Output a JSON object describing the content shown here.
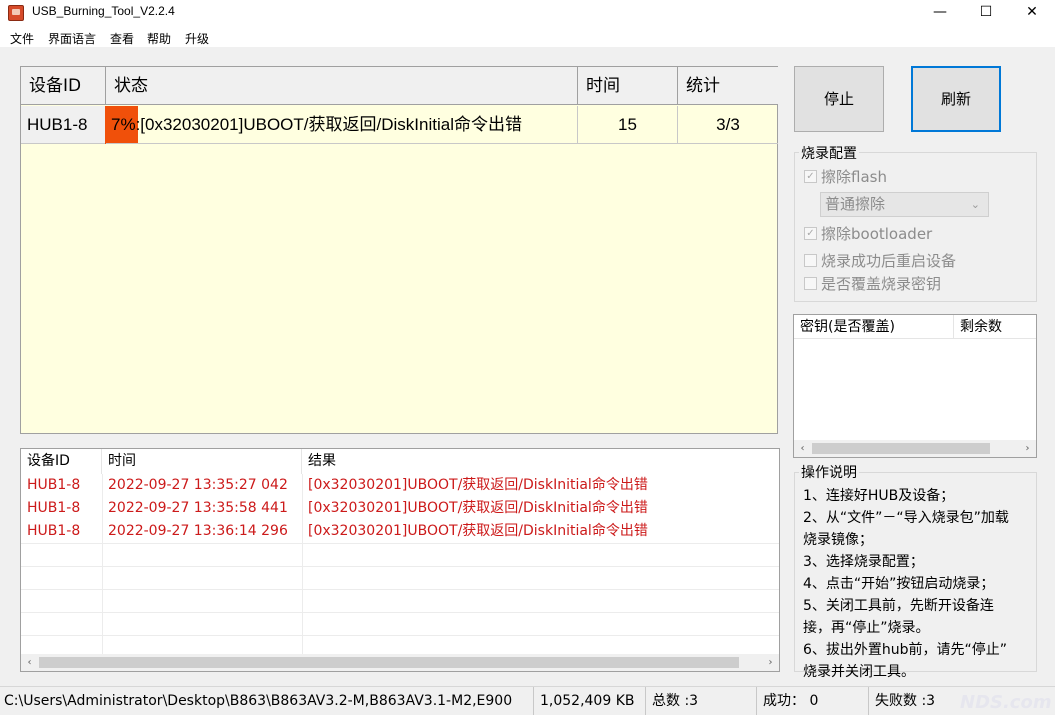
{
  "window": {
    "title": "USB_Burning_Tool_V2.2.4",
    "minimize": "—",
    "maximize": "☐",
    "close": "✕"
  },
  "menu": [
    "文件",
    "界面语言",
    "查看",
    "帮助",
    "升级"
  ],
  "device_grid": {
    "headers": [
      "设备ID",
      "状态",
      "时间",
      "统计"
    ],
    "rows": [
      {
        "device_id": "HUB1-8",
        "progress": "7%",
        "progress_value": 7,
        "status": ":[0x32030201]UBOOT/获取返回/DiskInitial命令出错",
        "time": "15",
        "count": "3/3"
      }
    ]
  },
  "buttons": {
    "stop": "停止",
    "refresh": "刷新"
  },
  "burn_config": {
    "title": "烧录配置",
    "erase_flash": {
      "label": "擦除flash",
      "checked": true
    },
    "erase_mode": "普通擦除",
    "erase_bootloader": {
      "label": "擦除bootloader",
      "checked": true
    },
    "reboot_after": {
      "label": "烧录成功后重启设备",
      "checked": false
    },
    "overwrite_key": {
      "label": "是否覆盖烧录密钥",
      "checked": false
    }
  },
  "key_list": {
    "headers": [
      "密钥(是否覆盖)",
      "剩余数"
    ]
  },
  "log_list": {
    "headers": [
      "设备ID",
      "时间",
      "结果"
    ],
    "rows": [
      {
        "device_id": "HUB1-8",
        "time": "2022-09-27 13:35:27 042",
        "result": "[0x32030201]UBOOT/获取返回/DiskInitial命令出错"
      },
      {
        "device_id": "HUB1-8",
        "time": "2022-09-27 13:35:58 441",
        "result": "[0x32030201]UBOOT/获取返回/DiskInitial命令出错"
      },
      {
        "device_id": "HUB1-8",
        "time": "2022-09-27 13:36:14 296",
        "result": "[0x32030201]UBOOT/获取返回/DiskInitial命令出错"
      }
    ]
  },
  "instructions": {
    "title": "操作说明",
    "lines": [
      "1、连接好HUB及设备；",
      "2、从“文件”－“导入烧录包”加载",
      "烧录镜像；",
      "3、选择烧录配置；",
      "4、点击“开始”按钮启动烧录；",
      "5、关闭工具前，先断开设备连",
      "接，再“停止”烧录。",
      "6、拔出外置hub前，请先“停止”",
      "烧录并关闭工具。"
    ]
  },
  "status_bar": {
    "path": "C:\\Users\\Administrator\\Desktop\\B863\\B863AV3.2-M,B863AV3.1-M2,E900",
    "size": "1,052,409 KB",
    "total": "总数 :3",
    "success": "成功： 0",
    "fail": "失败数 :3"
  },
  "watermark": "NDS.com"
}
